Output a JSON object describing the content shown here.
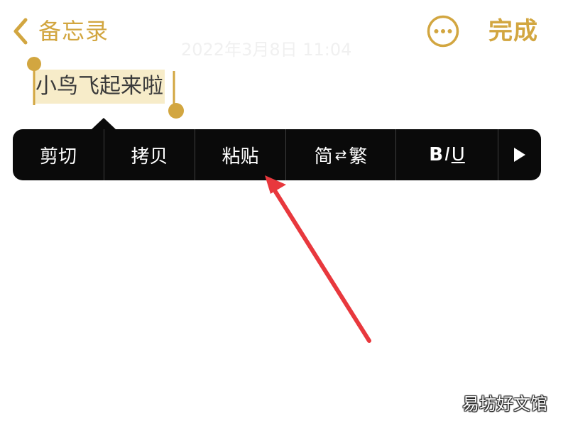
{
  "nav": {
    "back_label": "备忘录",
    "done_label": "完成",
    "more_icon": "ellipsis-circle-icon"
  },
  "note": {
    "date": "2022年3月8日 11:04",
    "selected_text": "小鸟飞起来啦"
  },
  "edit_menu": {
    "items": [
      {
        "label": "剪切"
      },
      {
        "label": "拷贝"
      },
      {
        "label": "粘贴"
      },
      {
        "from": "简",
        "arrow": "⇄",
        "to": "繁"
      },
      {
        "bold": "B",
        "italic": "I",
        "underline": "U"
      }
    ],
    "more_icon": "play-triangle-icon"
  },
  "annotation": {
    "arrow_color": "#e8383d"
  },
  "watermark": {
    "text": "易坊好文馆"
  },
  "colors": {
    "accent": "#d2a640",
    "selection_highlight": "#f7ecc9",
    "menu_background": "#0a0a0a"
  }
}
